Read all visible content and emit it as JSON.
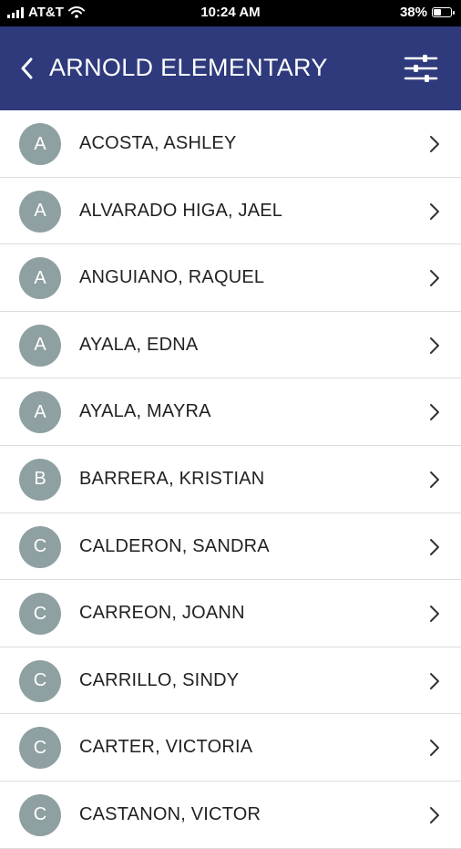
{
  "status_bar": {
    "carrier": "AT&T",
    "time": "10:24 AM",
    "battery": "38%",
    "battery_level": 0.38
  },
  "header": {
    "title": "ARNOLD ELEMENTARY",
    "back_icon": "chevron-left-icon",
    "filter_icon": "sliders-icon",
    "background_color": "#2e3a7c"
  },
  "list": {
    "avatar_color": "#8fa0a2",
    "items": [
      {
        "initial": "A",
        "name": "ACOSTA, ASHLEY"
      },
      {
        "initial": "A",
        "name": "ALVARADO HIGA, JAEL"
      },
      {
        "initial": "A",
        "name": "ANGUIANO, RAQUEL"
      },
      {
        "initial": "A",
        "name": "AYALA, EDNA"
      },
      {
        "initial": "A",
        "name": "AYALA, MAYRA"
      },
      {
        "initial": "B",
        "name": "BARRERA, KRISTIAN"
      },
      {
        "initial": "C",
        "name": "CALDERON, SANDRA"
      },
      {
        "initial": "C",
        "name": "CARREON, JOANN"
      },
      {
        "initial": "C",
        "name": "CARRILLO, SINDY"
      },
      {
        "initial": "C",
        "name": "CARTER, VICTORIA"
      },
      {
        "initial": "C",
        "name": "CASTANON, VICTOR"
      }
    ]
  }
}
